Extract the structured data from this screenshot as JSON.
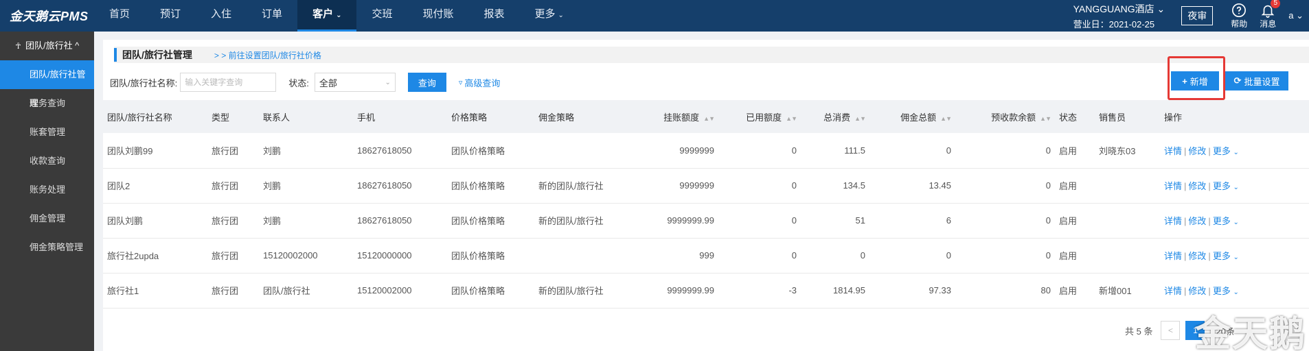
{
  "app": {
    "logo": "金天鹅云PMS"
  },
  "nav": [
    {
      "label": "首页",
      "active": false
    },
    {
      "label": "预订",
      "active": false
    },
    {
      "label": "入住",
      "active": false
    },
    {
      "label": "订单",
      "active": false
    },
    {
      "label": "客户",
      "active": true,
      "caret": "⌄"
    },
    {
      "label": "交班",
      "active": false
    },
    {
      "label": "现付账",
      "active": false
    },
    {
      "label": "报表",
      "active": false
    },
    {
      "label": "更多",
      "active": false,
      "caret": "⌄"
    }
  ],
  "header": {
    "hotel_name": "YANGGUANG酒店 ⌄",
    "business_date": "营业日：2021-02-25",
    "night_audit": "夜审",
    "help_label": "帮助",
    "message_label": "消息",
    "message_count": "5",
    "user": "a ⌄"
  },
  "sidebar": {
    "group_label": "团队/旅行社 ^",
    "items": [
      {
        "label": "团队/旅行社管理",
        "active": true
      },
      {
        "label": "账务查询"
      },
      {
        "label": "账套管理"
      },
      {
        "label": "收款查询"
      },
      {
        "label": "账务处理"
      },
      {
        "label": "佣金管理"
      },
      {
        "label": "佣金策略管理"
      }
    ]
  },
  "page": {
    "title": "团队/旅行社管理",
    "link": "> > 前往设置团队/旅行社价格"
  },
  "filter": {
    "name_label": "团队/旅行社名称:",
    "name_placeholder": "输入关键字查询",
    "status_label": "状态:",
    "status_value": "全部",
    "query_btn": "查询",
    "advanced_label": "高级查询"
  },
  "actions": {
    "add_label": "新增",
    "batch_label": "批量设置"
  },
  "table": {
    "columns": [
      "团队/旅行社名称",
      "类型",
      "联系人",
      "手机",
      "价格策略",
      "佣金策略",
      "挂账额度",
      "已用额度",
      "总消费",
      "佣金总额",
      "预收款余额",
      "状态",
      "销售员",
      "操作"
    ],
    "rows": [
      [
        "团队刘鹏99",
        "旅行团",
        "刘鹏",
        "18627618050",
        "团队价格策略",
        "",
        "9999999",
        "0",
        "111.5",
        "0",
        "0",
        "启用",
        "刘晓东03"
      ],
      [
        "团队2",
        "旅行团",
        "刘鹏",
        "18627618050",
        "团队价格策略",
        "新的团队/旅行社",
        "9999999",
        "0",
        "134.5",
        "13.45",
        "0",
        "启用",
        ""
      ],
      [
        "团队刘鹏",
        "旅行团",
        "刘鹏",
        "18627618050",
        "团队价格策略",
        "新的团队/旅行社",
        "9999999.99",
        "0",
        "51",
        "6",
        "0",
        "启用",
        ""
      ],
      [
        "旅行社2upda",
        "旅行团",
        "15120002000",
        "15120000000",
        "团队价格策略",
        "",
        "999",
        "0",
        "0",
        "0",
        "0",
        "启用",
        ""
      ],
      [
        "旅行社1",
        "旅行团",
        "团队/旅行社",
        "15120002000",
        "团队价格策略",
        "新的团队/旅行社",
        "9999999.99",
        "-3",
        "1814.95",
        "97.33",
        "80",
        "启用",
        "新增001"
      ]
    ],
    "ops": {
      "detail": "详情",
      "edit": "修改",
      "more": "更多"
    }
  },
  "pagination": {
    "total": "共 5 条",
    "prev": "<",
    "current": "1",
    "page_size": "20条"
  },
  "watermark": "金天鹅",
  "colors": {
    "topbar": "#153f6b",
    "accent": "#1e88e5",
    "sidebar": "#3a3a3a",
    "highlight": "#e53935"
  }
}
